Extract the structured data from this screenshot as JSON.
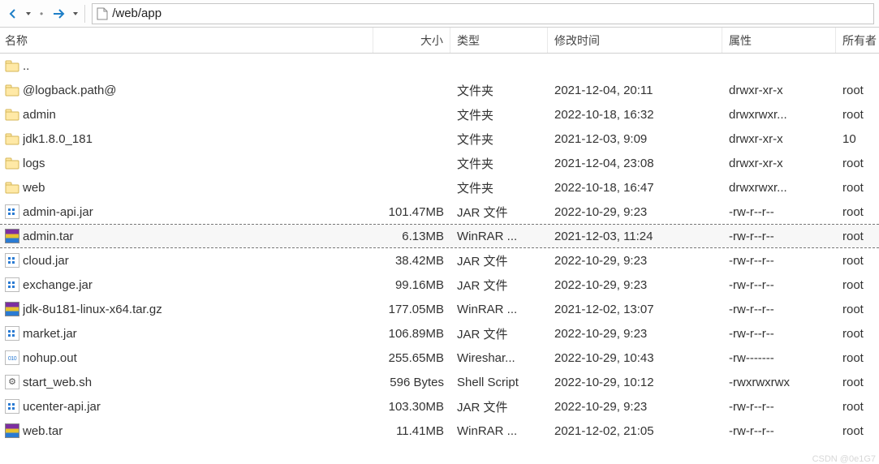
{
  "toolbar": {
    "path": "/web/app"
  },
  "columns": {
    "name": "名称",
    "size": "大小",
    "type": "类型",
    "date": "修改时间",
    "attr": "属性",
    "owner": "所有者"
  },
  "rows": [
    {
      "icon": "folder",
      "name": "..",
      "size": "",
      "type": "",
      "date": "",
      "attr": "",
      "owner": "",
      "selected": false
    },
    {
      "icon": "folder",
      "name": "@logback.path@",
      "size": "",
      "type": "文件夹",
      "date": "2021-12-04, 20:11",
      "attr": "drwxr-xr-x",
      "owner": "root",
      "selected": false
    },
    {
      "icon": "folder",
      "name": "admin",
      "size": "",
      "type": "文件夹",
      "date": "2022-10-18, 16:32",
      "attr": "drwxrwxr...",
      "owner": "root",
      "selected": false
    },
    {
      "icon": "folder",
      "name": "jdk1.8.0_181",
      "size": "",
      "type": "文件夹",
      "date": "2021-12-03, 9:09",
      "attr": "drwxr-xr-x",
      "owner": "10",
      "selected": false
    },
    {
      "icon": "folder",
      "name": "logs",
      "size": "",
      "type": "文件夹",
      "date": "2021-12-04, 23:08",
      "attr": "drwxr-xr-x",
      "owner": "root",
      "selected": false
    },
    {
      "icon": "folder",
      "name": "web",
      "size": "",
      "type": "文件夹",
      "date": "2022-10-18, 16:47",
      "attr": "drwxrwxr...",
      "owner": "root",
      "selected": false
    },
    {
      "icon": "jar",
      "name": "admin-api.jar",
      "size": "101.47MB",
      "type": "JAR 文件",
      "date": "2022-10-29, 9:23",
      "attr": "-rw-r--r--",
      "owner": "root",
      "selected": false
    },
    {
      "icon": "rar",
      "name": "admin.tar",
      "size": "6.13MB",
      "type": "WinRAR ...",
      "date": "2021-12-03, 11:24",
      "attr": "-rw-r--r--",
      "owner": "root",
      "selected": true
    },
    {
      "icon": "jar",
      "name": "cloud.jar",
      "size": "38.42MB",
      "type": "JAR 文件",
      "date": "2022-10-29, 9:23",
      "attr": "-rw-r--r--",
      "owner": "root",
      "selected": false
    },
    {
      "icon": "jar",
      "name": "exchange.jar",
      "size": "99.16MB",
      "type": "JAR 文件",
      "date": "2022-10-29, 9:23",
      "attr": "-rw-r--r--",
      "owner": "root",
      "selected": false
    },
    {
      "icon": "rar",
      "name": "jdk-8u181-linux-x64.tar.gz",
      "size": "177.05MB",
      "type": "WinRAR ...",
      "date": "2021-12-02, 13:07",
      "attr": "-rw-r--r--",
      "owner": "root",
      "selected": false
    },
    {
      "icon": "jar",
      "name": "market.jar",
      "size": "106.89MB",
      "type": "JAR 文件",
      "date": "2022-10-29, 9:23",
      "attr": "-rw-r--r--",
      "owner": "root",
      "selected": false
    },
    {
      "icon": "binary",
      "name": "nohup.out",
      "size": "255.65MB",
      "type": "Wireshar...",
      "date": "2022-10-29, 10:43",
      "attr": "-rw-------",
      "owner": "root",
      "selected": false
    },
    {
      "icon": "gear",
      "name": "start_web.sh",
      "size": "596 Bytes",
      "type": "Shell Script",
      "date": "2022-10-29, 10:12",
      "attr": "-rwxrwxrwx",
      "owner": "root",
      "selected": false
    },
    {
      "icon": "jar",
      "name": "ucenter-api.jar",
      "size": "103.30MB",
      "type": "JAR 文件",
      "date": "2022-10-29, 9:23",
      "attr": "-rw-r--r--",
      "owner": "root",
      "selected": false
    },
    {
      "icon": "rar",
      "name": "web.tar",
      "size": "11.41MB",
      "type": "WinRAR ...",
      "date": "2021-12-02, 21:05",
      "attr": "-rw-r--r--",
      "owner": "root",
      "selected": false
    }
  ],
  "watermark": "CSDN @0e1G7"
}
